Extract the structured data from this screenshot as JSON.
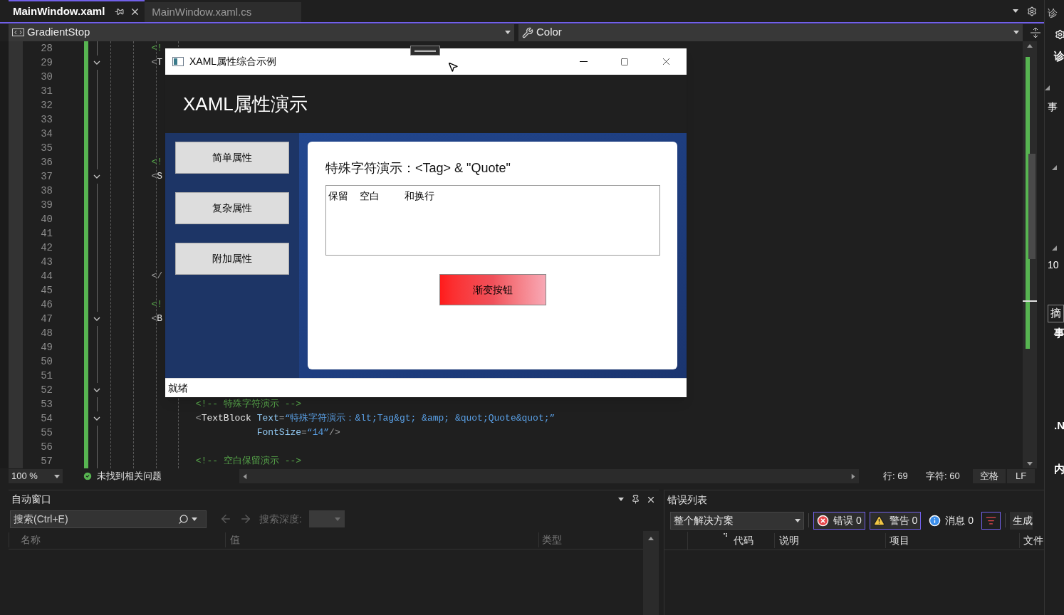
{
  "editor_tabs": [
    {
      "label": "MainWindow.xaml",
      "selected": true
    },
    {
      "label": "MainWindow.xaml.cs",
      "selected": false
    }
  ],
  "nav_bar": {
    "element": "GradientStop",
    "property": "Color"
  },
  "code_lines": [
    {
      "number": "28",
      "fold": false,
      "segments": [
        {
          "kind": "comment",
          "text": "        <!"
        }
      ]
    },
    {
      "number": "29",
      "fold": true,
      "segments": [
        {
          "kind": "punct",
          "text": "        <"
        },
        {
          "kind": "element",
          "text": "T"
        }
      ]
    },
    {
      "number": "30",
      "fold": false
    },
    {
      "number": "31",
      "fold": false
    },
    {
      "number": "32",
      "fold": false
    },
    {
      "number": "33",
      "fold": false
    },
    {
      "number": "34",
      "fold": false
    },
    {
      "number": "35",
      "fold": false
    },
    {
      "number": "36",
      "fold": false,
      "segments": [
        {
          "kind": "comment",
          "text": "        <!"
        }
      ]
    },
    {
      "number": "37",
      "fold": true,
      "segments": [
        {
          "kind": "punct",
          "text": "        <"
        },
        {
          "kind": "element",
          "text": "S"
        }
      ]
    },
    {
      "number": "38",
      "fold": false
    },
    {
      "number": "39",
      "fold": false
    },
    {
      "number": "40",
      "fold": false
    },
    {
      "number": "41",
      "fold": false
    },
    {
      "number": "42",
      "fold": false
    },
    {
      "number": "43",
      "fold": false
    },
    {
      "number": "44",
      "fold": false,
      "segments": [
        {
          "kind": "punct",
          "text": "        </"
        }
      ]
    },
    {
      "number": "45",
      "fold": false
    },
    {
      "number": "46",
      "fold": false,
      "segments": [
        {
          "kind": "comment",
          "text": "        <!"
        }
      ]
    },
    {
      "number": "47",
      "fold": true,
      "segments": [
        {
          "kind": "punct",
          "text": "        <"
        },
        {
          "kind": "element",
          "text": "B"
        }
      ]
    },
    {
      "number": "48",
      "fold": false
    },
    {
      "number": "49",
      "fold": false
    },
    {
      "number": "50",
      "fold": false
    },
    {
      "number": "51",
      "fold": false
    },
    {
      "number": "52",
      "fold": true
    },
    {
      "number": "53",
      "fold": false,
      "segments": [
        {
          "kind": "comment",
          "text": "                <!-- 特殊字符演示 -->"
        }
      ]
    },
    {
      "number": "54",
      "fold": true,
      "segments": [
        {
          "kind": "punct",
          "text": "                <"
        },
        {
          "kind": "element",
          "text": "TextBlock"
        },
        {
          "kind": "attr",
          "text": " Text"
        },
        {
          "kind": "punct",
          "text": "="
        },
        {
          "kind": "value",
          "text": "“特殊字符演示：&lt;Tag&gt; &amp; &quot;Quote&quot;”"
        }
      ]
    },
    {
      "number": "55",
      "fold": false,
      "segments": [
        {
          "kind": "attr",
          "text": "                           FontSize"
        },
        {
          "kind": "punct",
          "text": "="
        },
        {
          "kind": "value",
          "text": "“14”"
        },
        {
          "kind": "punct",
          "text": "/>"
        }
      ]
    },
    {
      "number": "56",
      "fold": false
    },
    {
      "number": "57",
      "fold": false,
      "segments": [
        {
          "kind": "comment",
          "text": "                <!-- 空白保留演示 -->"
        }
      ]
    }
  ],
  "app_window": {
    "title": "XAML属性综合示例",
    "header": "XAML属性演示",
    "nav_buttons": [
      "简单属性",
      "复杂属性",
      "附加属性"
    ],
    "special_text": "特殊字符演示：<Tag> & \"Quote\"",
    "whitespace_text": "保留    空白         和换行",
    "gradient_button": "渐变按钮",
    "status": "就绪"
  },
  "status_bar": {
    "zoom": "100 %",
    "issues": "未找到相关问题",
    "line": "行: 69",
    "char": "字符: 60",
    "indent": "空格",
    "line_ending": "LF"
  },
  "autos_panel": {
    "title": "自动窗口",
    "search_placeholder": "搜索(Ctrl+E)",
    "depth_label": "搜索深度:",
    "columns": [
      "名称",
      "值",
      "类型"
    ]
  },
  "error_list": {
    "title": "错误列表",
    "scope": "整个解决方案",
    "filters": [
      {
        "kind": "error",
        "label": "错误 0",
        "selected": true
      },
      {
        "kind": "warning",
        "label": "警告 0",
        "selected": true
      },
      {
        "kind": "info",
        "label": "消息 0",
        "selected": false
      }
    ],
    "build": "生成",
    "columns": [
      "代码",
      "说明",
      "项目",
      "文件"
    ]
  },
  "side_panel": {
    "items": [
      {
        "kind": "title",
        "text": "诊"
      },
      {
        "kind": "heading",
        "text": "诊"
      },
      {
        "kind": "node",
        "text": "事"
      },
      {
        "kind": "node",
        "text": "10"
      },
      {
        "kind": "tab",
        "text": "摘"
      },
      {
        "kind": "heading",
        "text": "事"
      },
      {
        "kind": "heading",
        "text": ".N"
      },
      {
        "kind": "heading",
        "text": "内"
      }
    ]
  }
}
